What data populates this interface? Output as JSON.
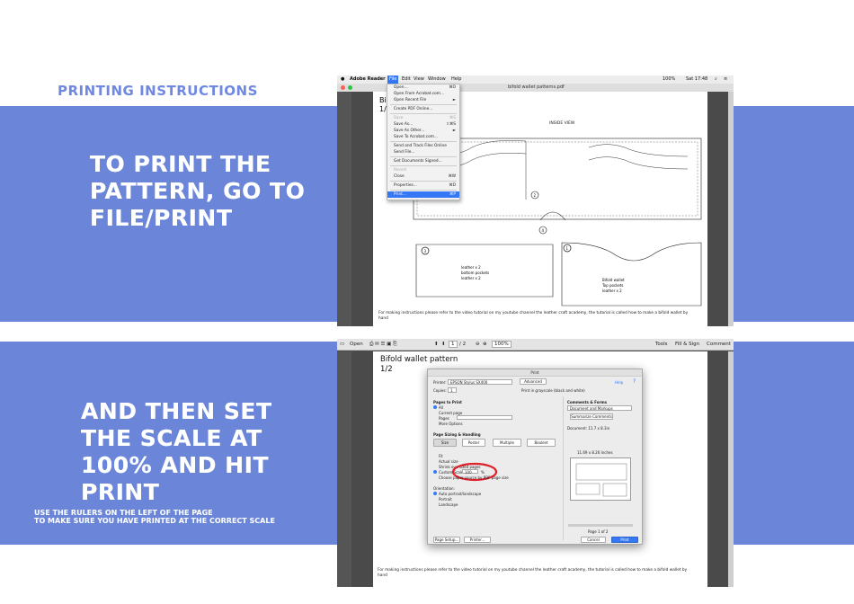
{
  "heading": "Printing instructions",
  "step1": "To print the pattern, go to file/print",
  "step2": "And then set the scale at 100% and hit print",
  "tip_line1": "Use the rulers on the left of the page",
  "tip_line2": "to make sure you have printed at the correct scale",
  "colors": {
    "band": "#6b86d9",
    "heading": "#7088e0",
    "highlight": "#3478f6",
    "circle": "#e0202a"
  },
  "shot1": {
    "app_name": "Adobe Reader",
    "menus": [
      "File",
      "Edit",
      "View",
      "Window",
      "Help"
    ],
    "clock": "Sat 17:48",
    "battery": "100%",
    "window_title": "bifold wallet patterns.pdf",
    "page_title_partial": "Bif",
    "page_number_partial": "1/",
    "inside_view_label": "INSIDE VIEW",
    "file_menu": [
      {
        "label": "Open...",
        "shortcut": "⌘O"
      },
      {
        "label": "Open From Acrobat.com...",
        "shortcut": ""
      },
      {
        "label": "Open Recent File",
        "shortcut": "►"
      },
      {
        "sep": true
      },
      {
        "label": "Create PDF Online...",
        "shortcut": ""
      },
      {
        "sep": true
      },
      {
        "label": "Save",
        "shortcut": "⌘S",
        "dim": true
      },
      {
        "label": "Save As...",
        "shortcut": "⇧⌘S"
      },
      {
        "label": "Save As Other...",
        "shortcut": "►"
      },
      {
        "label": "Save To Acrobat.com...",
        "shortcut": ""
      },
      {
        "sep": true
      },
      {
        "label": "Send and Track Files Online",
        "shortcut": ""
      },
      {
        "label": "Send File...",
        "shortcut": ""
      },
      {
        "sep": true
      },
      {
        "label": "Get Documents Signed...",
        "shortcut": ""
      },
      {
        "sep": true
      },
      {
        "label": "Revert",
        "shortcut": "",
        "dim": true
      },
      {
        "label": "Close",
        "shortcut": "⌘W"
      },
      {
        "sep": true
      },
      {
        "label": "Properties...",
        "shortcut": "⌘D"
      },
      {
        "sep": true
      },
      {
        "label": "Print...",
        "shortcut": "⌘P",
        "hi": true
      }
    ],
    "piece_labels": {
      "circle2": "2",
      "circle3": "3",
      "circle4": "4",
      "circle1": "1",
      "bottom_left_text": [
        "leather x 2",
        "bottom pockets",
        "leather x 2"
      ],
      "bottom_right_text": [
        "Bifold wallet",
        "Top pockets",
        "leather x 2"
      ]
    },
    "footnote": "For making instructions please refer to the video tutorial on my youtube channel the leather craft academy, the tutorial is called how to make a bifold wallet by hand"
  },
  "shot2": {
    "toolbar": {
      "open": "Open",
      "page_input": "1",
      "page_total": "/ 2",
      "zoom": "100%",
      "tools": "Tools",
      "fill_sign": "Fill & Sign",
      "comment": "Comment"
    },
    "page_title": "Bifold wallet pattern",
    "page_number": "1/2",
    "dialog": {
      "title": "Print",
      "printer_label": "Printer:",
      "printer_value": "EPSON Stylus SX400",
      "advanced": "Advanced",
      "help": "Help",
      "copies_label": "Copies:",
      "copies_value": "1",
      "grayscale": "Print in grayscale (black and white)",
      "pages_heading": "Pages to Print",
      "pages_options": [
        "All",
        "Current page",
        "Pages",
        "More Options"
      ],
      "sizing_heading": "Page Sizing & Handling",
      "sizing_tabs": [
        "Size",
        "Poster",
        "Multiple",
        "Booklet"
      ],
      "fit": "Fit",
      "actual_size": "Actual size",
      "shrink": "Shrink oversized pages",
      "custom_scale": "Custom Scale:",
      "scale_value": "100",
      "scale_unit": "%",
      "paper_source": "Choose paper source by PDF page size",
      "orientation_heading": "Orientation:",
      "orientation_options": [
        "Auto portrait/landscape",
        "Portrait",
        "Landscape"
      ],
      "comments_heading": "Comments & Forms",
      "comments_value": "Document and Markups",
      "summarize": "Summarize Comments",
      "document_size": "Document: 11.7 x 8.3in",
      "preview_size": "11.69 x 8.26 Inches",
      "page_of": "Page 1 of 2",
      "page_setup": "Page Setup...",
      "printer_btn": "Printer...",
      "cancel": "Cancel",
      "print": "Print"
    },
    "footnote": "For making instructions please refer to the video tutorial on my youtube channel the leather craft academy, the tutorial is called how to make a bifold wallet by hand"
  }
}
